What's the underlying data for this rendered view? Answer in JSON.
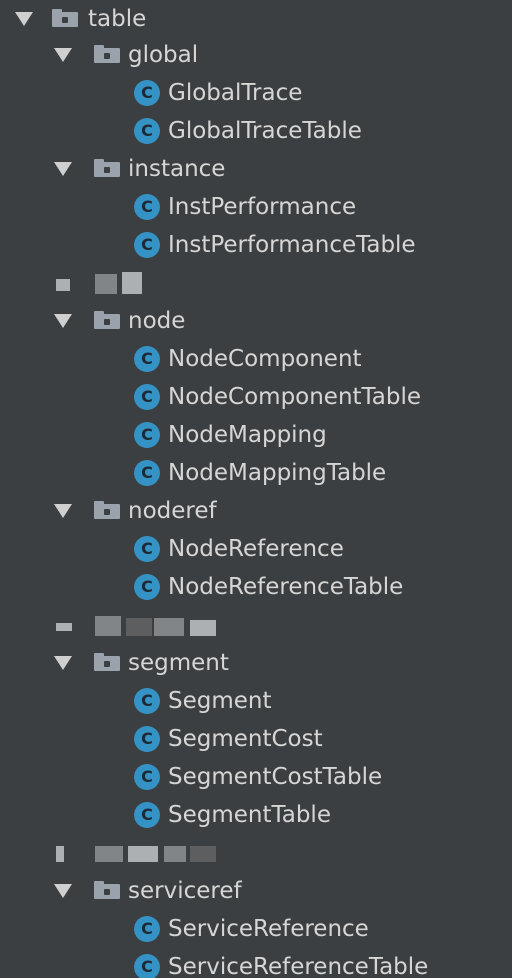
{
  "tree": {
    "root": {
      "label": "table",
      "icon": "folder-icon",
      "expanded": true
    },
    "packages": [
      {
        "label": "global",
        "icon": "folder-icon",
        "expanded": true,
        "classes": [
          "GlobalTrace",
          "GlobalTraceTable"
        ]
      },
      {
        "label": "instance",
        "icon": "folder-icon",
        "expanded": true,
        "classes": [
          "InstPerformance",
          "InstPerformanceTable"
        ]
      },
      {
        "label": "node",
        "icon": "folder-icon",
        "expanded": true,
        "classes": [
          "NodeComponent",
          "NodeComponentTable",
          "NodeMapping",
          "NodeMappingTable"
        ]
      },
      {
        "label": "noderef",
        "icon": "folder-icon",
        "expanded": true,
        "classes": [
          "NodeReference",
          "NodeReferenceTable"
        ]
      },
      {
        "label": "segment",
        "icon": "folder-icon",
        "expanded": true,
        "classes": [
          "Segment",
          "SegmentCost",
          "SegmentCostTable",
          "SegmentTable"
        ]
      },
      {
        "label": "serviceref",
        "icon": "folder-icon",
        "expanded": true,
        "classes": [
          "ServiceReference",
          "ServiceReferenceTable"
        ]
      }
    ],
    "class_icon_letter": "C",
    "colors": {
      "background": "#3c3f41",
      "class_icon": "#3592c4",
      "folder": "#9aa3ab",
      "text": "#d6d6d6"
    }
  }
}
